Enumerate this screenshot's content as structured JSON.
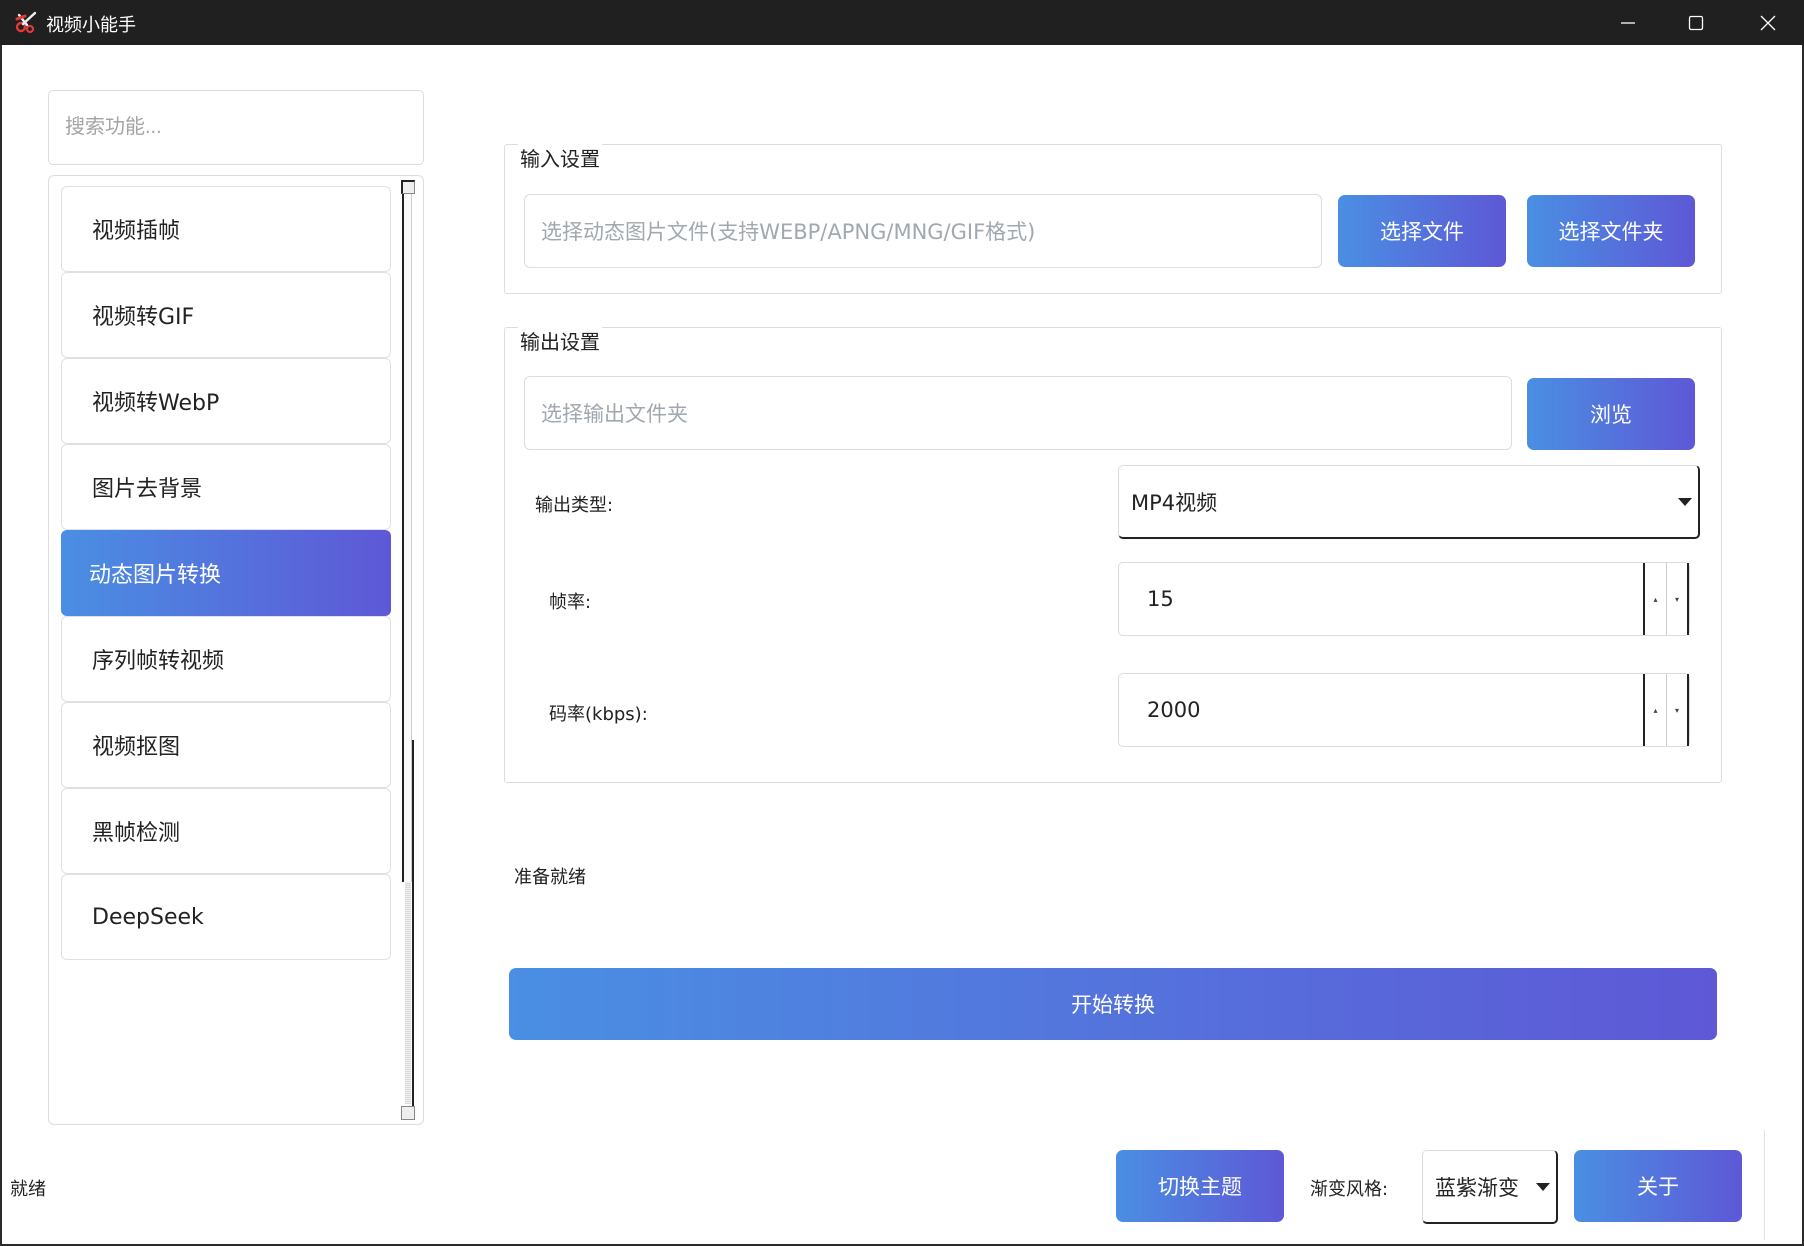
{
  "window": {
    "title": "视频小能手",
    "icon": "scissors-icon",
    "controls": {
      "minimize": "minimize-icon",
      "maximize": "maximize-icon",
      "close": "close-icon"
    }
  },
  "sidebar": {
    "search_placeholder": "搜索功能...",
    "items": [
      {
        "label": "视频插帧",
        "active": false
      },
      {
        "label": "视频转GIF",
        "active": false
      },
      {
        "label": "视频转WebP",
        "active": false
      },
      {
        "label": "图片去背景",
        "active": false
      },
      {
        "label": "动态图片转换",
        "active": true
      },
      {
        "label": "序列帧转视频",
        "active": false
      },
      {
        "label": "视频抠图",
        "active": false
      },
      {
        "label": "黑帧检测",
        "active": false
      },
      {
        "label": "DeepSeek",
        "active": false
      }
    ]
  },
  "input_group": {
    "title": "输入设置",
    "file_placeholder": "选择动态图片文件(支持WEBP/APNG/MNG/GIF格式)",
    "select_file_label": "选择文件",
    "select_folder_label": "选择文件夹"
  },
  "output_group": {
    "title": "输出设置",
    "folder_placeholder": "选择输出文件夹",
    "browse_label": "浏览",
    "type_label": "输出类型:",
    "type_value": "MP4视频",
    "fps_label": "帧率:",
    "fps_value": "15",
    "bitrate_label": "码率(kbps):",
    "bitrate_value": "2000"
  },
  "status_text": "准备就绪",
  "start_label": "开始转换",
  "bottom": {
    "status": "就绪",
    "theme_button": "切换主题",
    "gradient_label": "渐变风格:",
    "gradient_value": "蓝紫渐变",
    "about_button": "关于"
  },
  "colors": {
    "gradient_start": "#4a8fe3",
    "gradient_end": "#5e58d6",
    "titlebar": "#202020"
  }
}
